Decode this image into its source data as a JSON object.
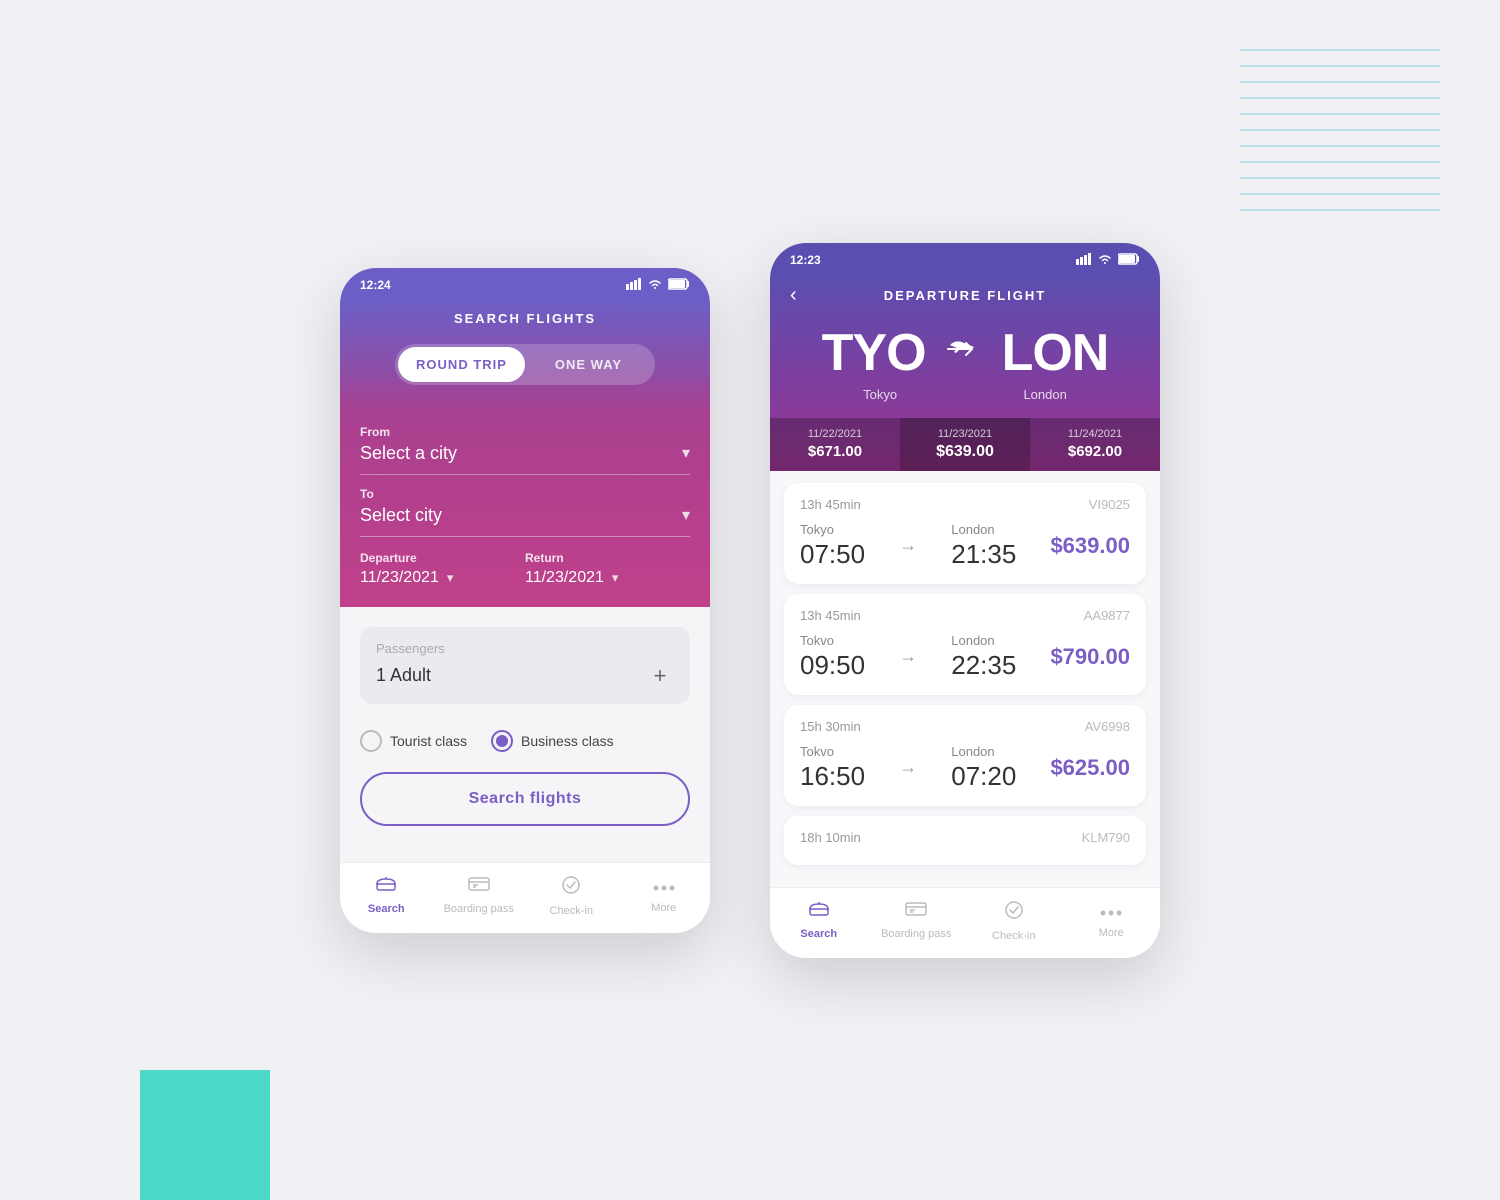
{
  "background": {
    "teal_block": true,
    "lines_decoration": true
  },
  "phone1": {
    "status_bar": {
      "time": "12:24",
      "signal": "▲▲▲",
      "wifi": "wifi",
      "battery": "battery"
    },
    "header": {
      "title": "SEARCH FLIGHTS"
    },
    "toggle": {
      "round_trip": "ROUND TRIP",
      "one_way": "ONE WAY",
      "active": "round_trip"
    },
    "from_field": {
      "label": "From",
      "placeholder": "Select a city"
    },
    "to_field": {
      "label": "To",
      "placeholder": "Select city"
    },
    "departure": {
      "label": "Departure",
      "value": "11/23/2021"
    },
    "return": {
      "label": "Return",
      "value": "11/23/2021"
    },
    "passengers": {
      "label": "Passengers",
      "value": "1 Adult"
    },
    "class": {
      "tourist": "Tourist class",
      "business": "Business class",
      "selected": "business"
    },
    "search_button": "Search flights",
    "nav": {
      "items": [
        {
          "label": "Search",
          "active": true
        },
        {
          "label": "Boarding pass",
          "active": false
        },
        {
          "label": "Check-in",
          "active": false
        },
        {
          "label": "More",
          "active": false
        }
      ]
    }
  },
  "phone2": {
    "status_bar": {
      "time": "12:23"
    },
    "header": {
      "title": "DEPARTURE FLIGHT",
      "back": "‹"
    },
    "route": {
      "from_code": "TYO",
      "from_city": "Tokyo",
      "to_code": "LON",
      "to_city": "London"
    },
    "date_prices": [
      {
        "date": "11/22/2021",
        "price": "$671.00",
        "selected": false
      },
      {
        "date": "11/23/2021",
        "price": "$639.00",
        "selected": true
      },
      {
        "date": "11/24/2021",
        "price": "$692.00",
        "selected": false
      }
    ],
    "flights": [
      {
        "duration": "13h 45min",
        "code": "VI9025",
        "from_city": "Tokyo",
        "from_time": "07:50",
        "to_city": "London",
        "to_time": "21:35",
        "price": "$639.00"
      },
      {
        "duration": "13h 45min",
        "code": "AA9877",
        "from_city": "Tokvo",
        "from_time": "09:50",
        "to_city": "London",
        "to_time": "22:35",
        "price": "$790.00"
      },
      {
        "duration": "15h 30min",
        "code": "AV6998",
        "from_city": "Tokvo",
        "from_time": "16:50",
        "to_city": "London",
        "to_time": "07:20",
        "price": "$625.00"
      },
      {
        "duration": "18h 10min",
        "code": "KLM790",
        "from_city": "",
        "from_time": "",
        "to_city": "",
        "to_time": "",
        "price": ""
      }
    ],
    "nav": {
      "items": [
        {
          "label": "Search",
          "active": true
        },
        {
          "label": "Boarding pass",
          "active": false
        },
        {
          "label": "Check-in",
          "active": false
        },
        {
          "label": "More",
          "active": false
        }
      ]
    }
  }
}
